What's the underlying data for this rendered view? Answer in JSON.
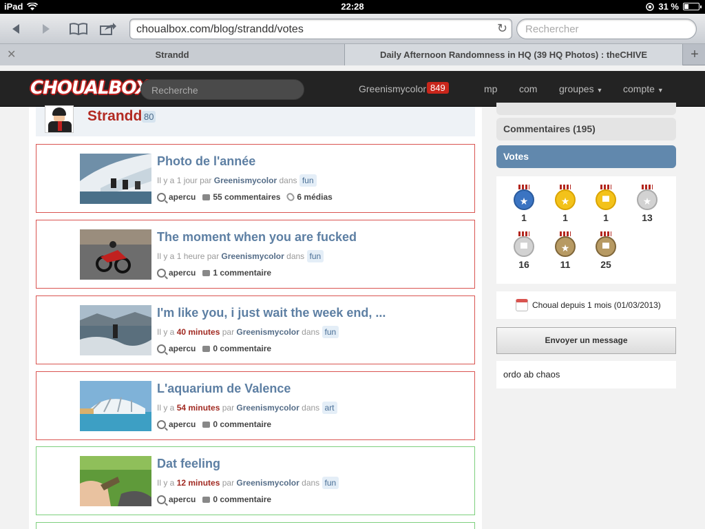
{
  "status": {
    "device": "iPad",
    "time": "22:28",
    "battery": "31 %",
    "battery_level": 0.31
  },
  "browser": {
    "url": "choualbox.com/blog/strandd/votes",
    "search_placeholder": "Rechercher",
    "tabs": [
      {
        "title": "Strandd"
      },
      {
        "title": "Daily Afternoon Randomness in HQ (39 HQ Photos) : theCHIVE"
      }
    ]
  },
  "site": {
    "logo": "CHOUALBOX",
    "search_placeholder": "Recherche",
    "user": "Greenismycolor",
    "user_badge": "849",
    "nav": [
      "mp",
      "com",
      "groupes",
      "compte"
    ]
  },
  "profile": {
    "name": "Strandd",
    "score": "80"
  },
  "labels": {
    "ago_prefix": "Il y a",
    "by": "par",
    "in": "dans",
    "apercu": "apercu"
  },
  "posts": [
    {
      "title": "Photo de l'année",
      "time": "1 jour",
      "time_highlight": false,
      "author": "Greenismycolor",
      "tag": "fun",
      "comments": "55 commentaires",
      "medias": "6 médias",
      "border": "red"
    },
    {
      "title": "The moment when you are fucked",
      "time": "1 heure",
      "time_highlight": false,
      "author": "Greenismycolor",
      "tag": "fun",
      "comments": "1 commentaire",
      "border": "red"
    },
    {
      "title": "I'm like you, i just wait the week end, ...",
      "time": "40 minutes",
      "time_highlight": true,
      "author": "Greenismycolor",
      "tag": "fun",
      "comments": "0 commentaire",
      "border": "red"
    },
    {
      "title": "L'aquarium de Valence",
      "time": "54 minutes",
      "time_highlight": true,
      "author": "Greenismycolor",
      "tag": "art",
      "comments": "0 commentaire",
      "border": "red"
    },
    {
      "title": "Dat feeling",
      "time": "12 minutes",
      "time_highlight": true,
      "author": "Greenismycolor",
      "tag": "fun",
      "comments": "0 commentaire",
      "border": "green"
    }
  ],
  "sidebar": {
    "tab_comments": "Commentaires (195)",
    "tab_votes": "Votes",
    "medals": [
      {
        "icon": "star",
        "color": "#3b74c2",
        "count": "1"
      },
      {
        "icon": "star",
        "color": "#f3c21a",
        "count": "1"
      },
      {
        "icon": "comment",
        "color": "#f3c21a",
        "count": "1"
      },
      {
        "icon": "star",
        "color": "#c8c8c8",
        "count": "13"
      },
      {
        "icon": "comment",
        "color": "#c8c8c8",
        "count": "16"
      },
      {
        "icon": "star",
        "color": "#a88a55",
        "count": "11"
      },
      {
        "icon": "comment",
        "color": "#a88a55",
        "count": "25"
      }
    ],
    "since": "Choual depuis 1 mois (01/03/2013)",
    "send_message": "Envoyer un message",
    "motto": "ordo ab chaos"
  }
}
